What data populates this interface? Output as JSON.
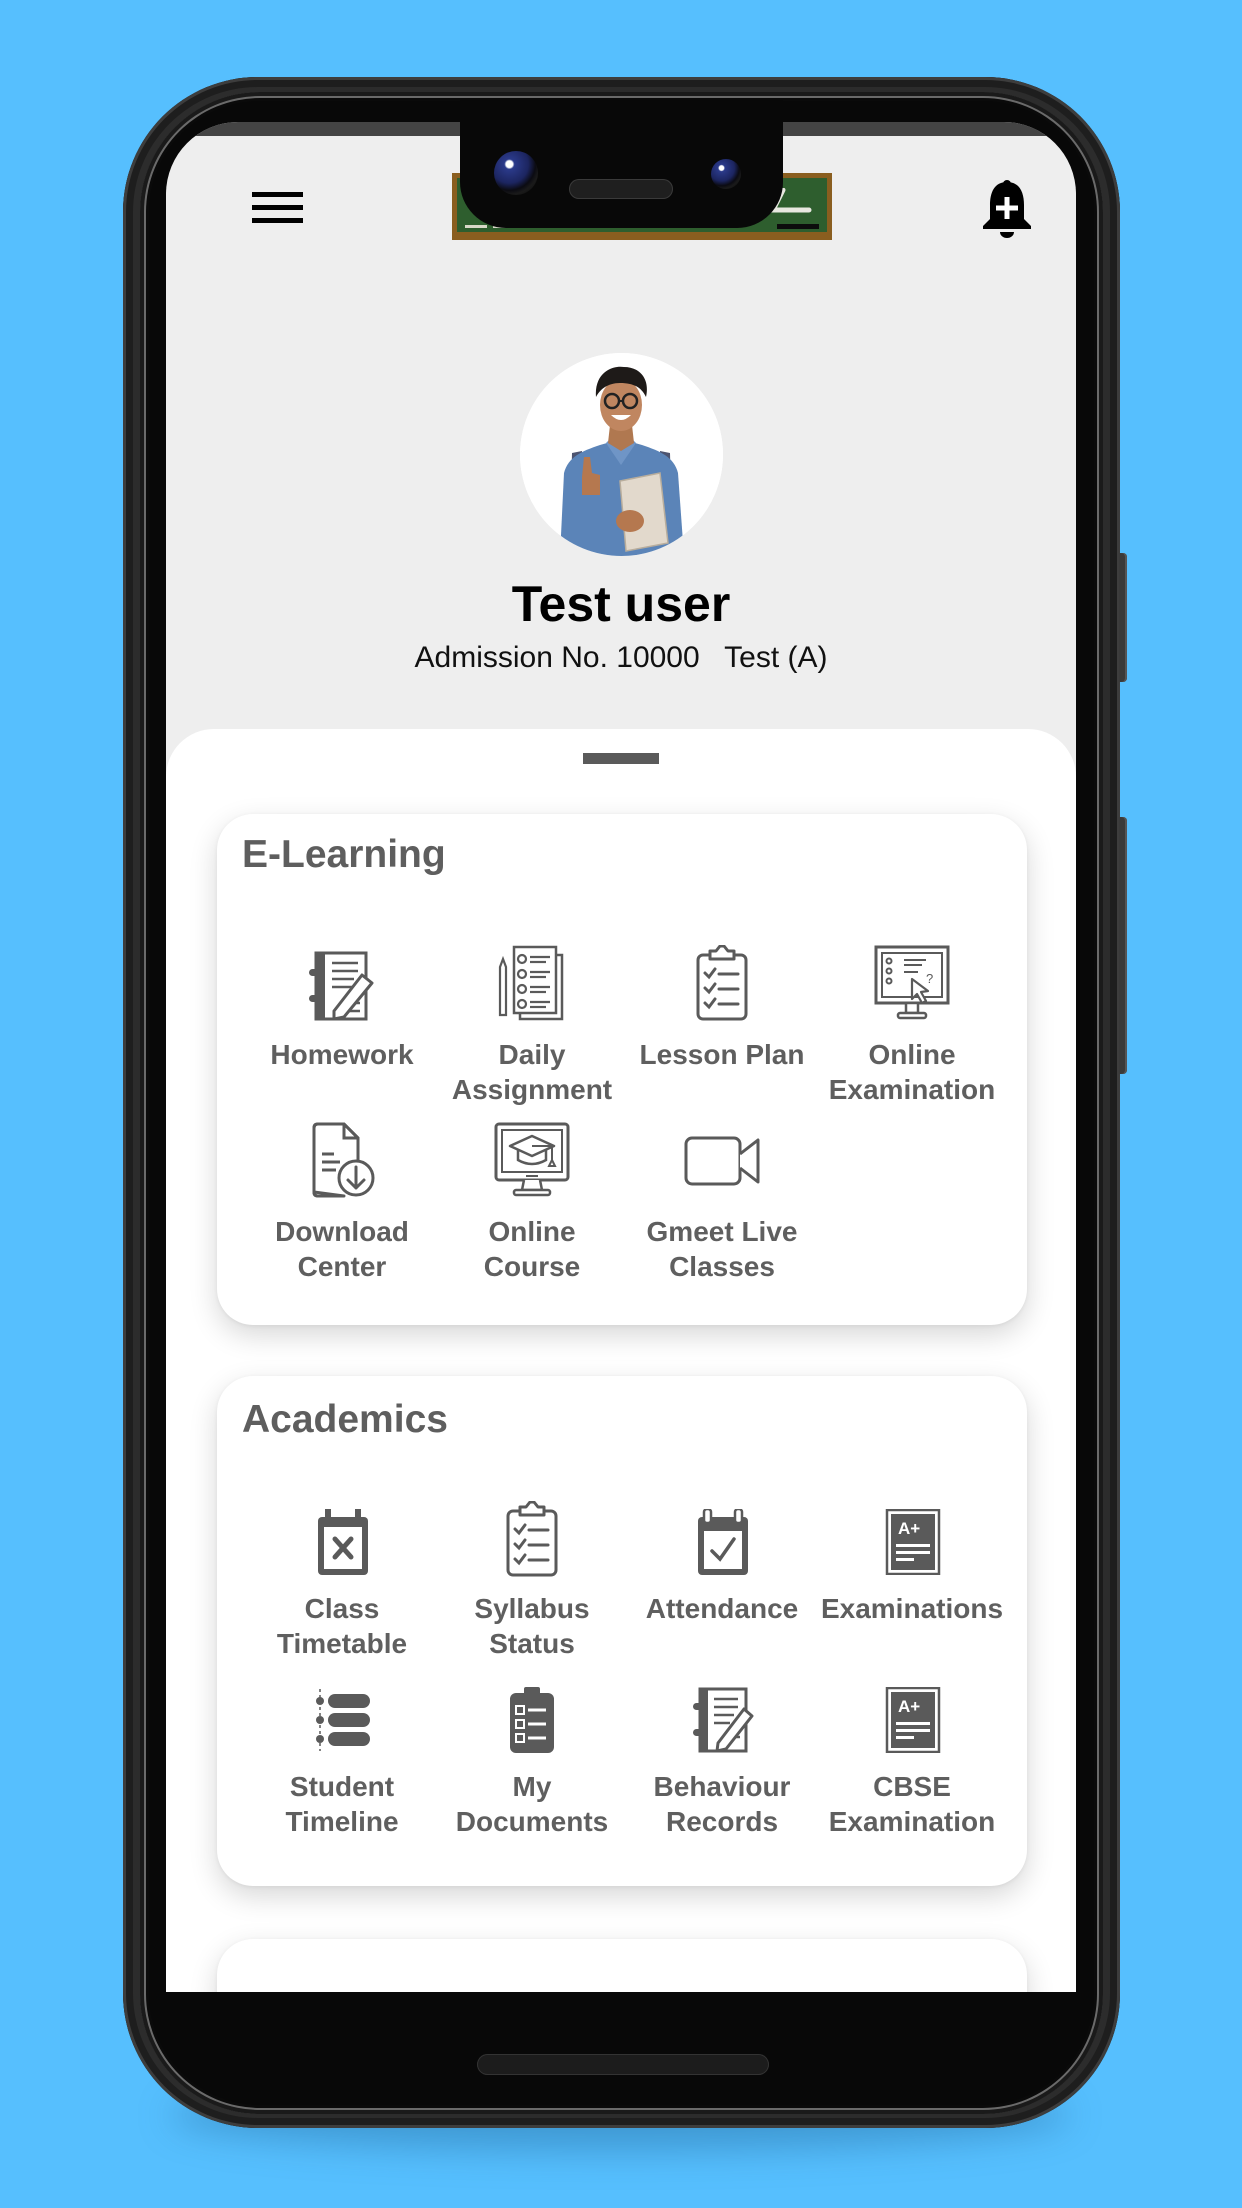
{
  "header": {
    "menu_icon": "hamburger-menu-icon",
    "logo": "school-chalkboard-logo",
    "notification_icon": "bell-plus-icon"
  },
  "profile": {
    "name": "Test user",
    "admission_label": "Admission No.",
    "admission_number": "10000",
    "class_section": "Test (A)",
    "admission_line": "Admission No. 10000   Test (A)"
  },
  "colors": {
    "background": "#56bffe",
    "screen_bg": "#eeeeee",
    "card_bg": "#ffffff",
    "icon_gray": "#5a5a5a",
    "text_gray": "#5f5f5f"
  },
  "sections": [
    {
      "title": "E-Learning",
      "items": [
        {
          "label": "Homework",
          "icon": "homework-notebook-pencil-icon"
        },
        {
          "label": "Daily Assignment",
          "icon": "checklist-document-icon"
        },
        {
          "label": "Lesson Plan",
          "icon": "clipboard-checklist-icon"
        },
        {
          "label": "Online Examination",
          "icon": "monitor-quiz-icon"
        },
        {
          "label": "Download Center",
          "icon": "document-download-icon"
        },
        {
          "label": "Online Course",
          "icon": "monitor-graduation-cap-icon"
        },
        {
          "label": "Gmeet Live Classes",
          "icon": "video-camera-icon"
        }
      ]
    },
    {
      "title": "Academics",
      "items": [
        {
          "label": "Class Timetable",
          "icon": "calendar-x-icon"
        },
        {
          "label": "Syllabus Status",
          "icon": "clipboard-checklist-icon"
        },
        {
          "label": "Attendance",
          "icon": "calendar-check-icon"
        },
        {
          "label": "Examinations",
          "icon": "grade-report-icon"
        },
        {
          "label": "Student Timeline",
          "icon": "timeline-list-icon"
        },
        {
          "label": "My Documents",
          "icon": "clipboard-documents-icon"
        },
        {
          "label": "Behaviour Records",
          "icon": "notebook-pencil-icon"
        },
        {
          "label": "CBSE Examination",
          "icon": "grade-report-icon"
        }
      ]
    }
  ]
}
